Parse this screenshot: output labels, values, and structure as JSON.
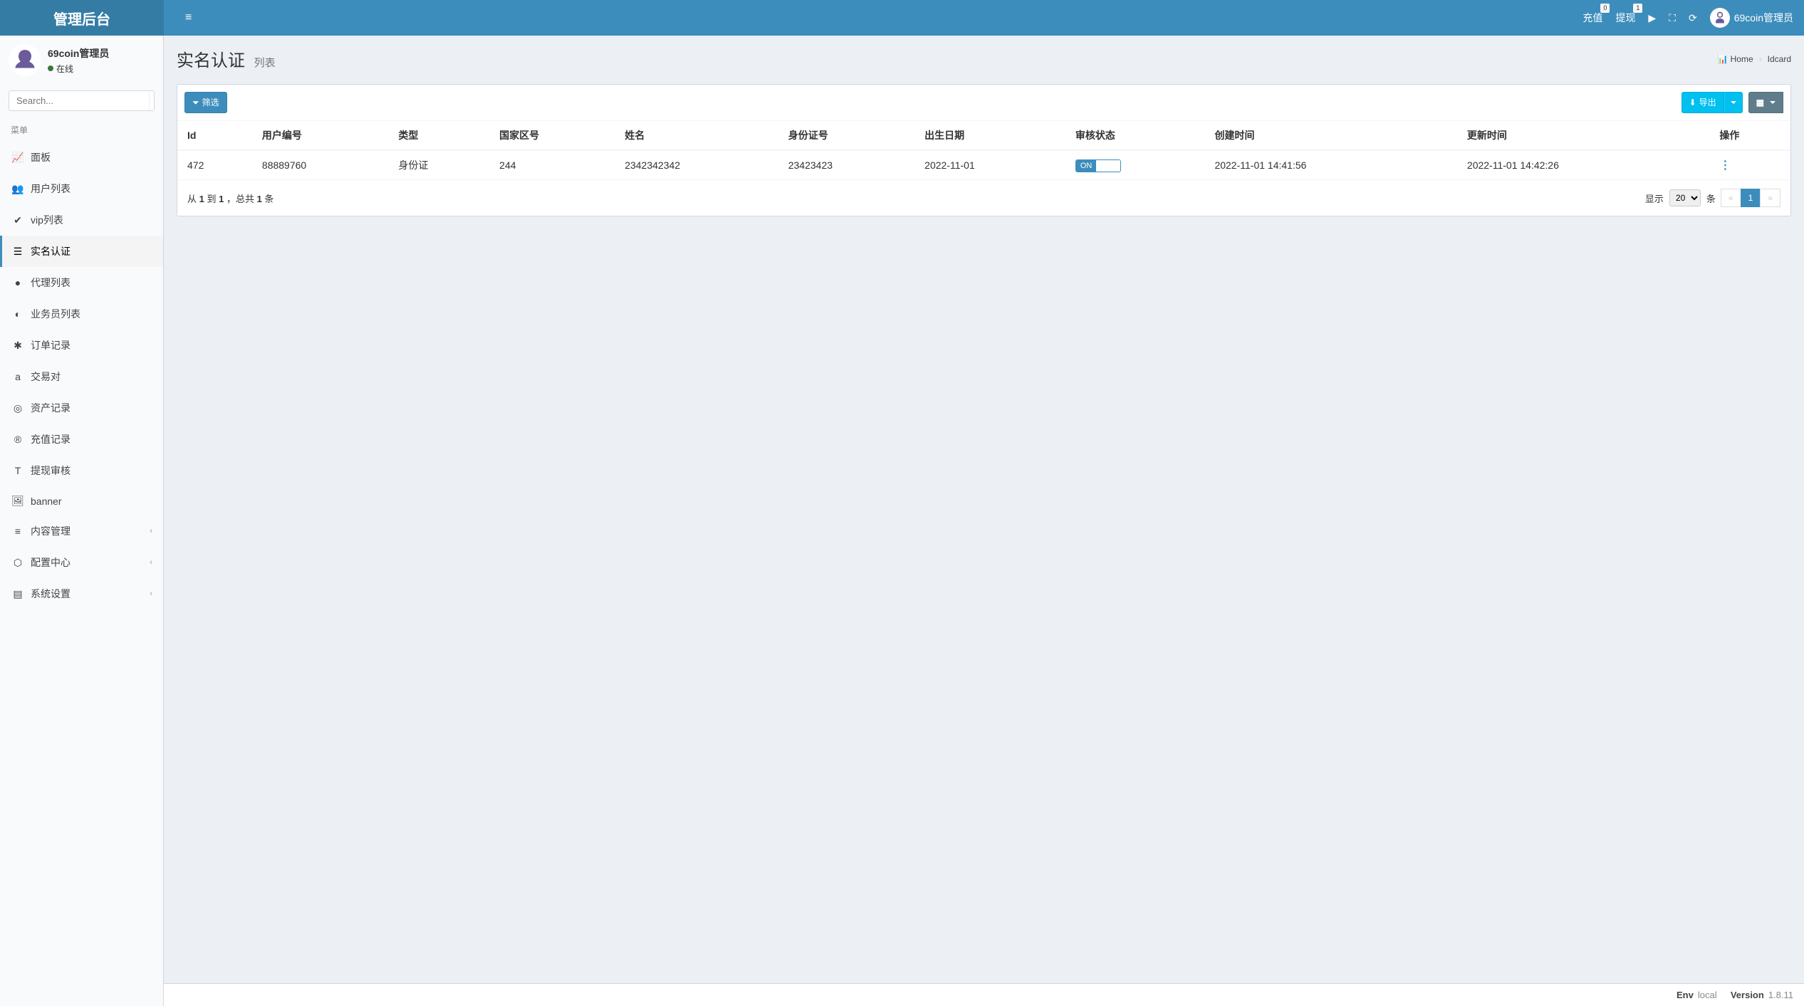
{
  "brand": "管理后台",
  "header": {
    "recharge": {
      "label": "充值",
      "badge": "0"
    },
    "withdraw": {
      "label": "提现",
      "badge": "1"
    },
    "username": "69coin管理员"
  },
  "sidebar": {
    "user": {
      "name": "69coin管理员",
      "status": "在线"
    },
    "search_placeholder": "Search...",
    "menu_header": "菜单",
    "items": [
      {
        "label": "面板",
        "icon": "📈"
      },
      {
        "label": "用户列表",
        "icon": "👥"
      },
      {
        "label": "vip列表",
        "icon": "✔"
      },
      {
        "label": "实名认证",
        "icon": "☰",
        "active": true
      },
      {
        "label": "代理列表",
        "icon": "●"
      },
      {
        "label": "业务员列表",
        "icon": "◐"
      },
      {
        "label": "订单记录",
        "icon": "✱"
      },
      {
        "label": "交易对",
        "icon": "a"
      },
      {
        "label": "资产记录",
        "icon": "◎"
      },
      {
        "label": "充值记录",
        "icon": "®"
      },
      {
        "label": "提现审核",
        "icon": "T"
      },
      {
        "label": "banner",
        "icon": "🖼"
      },
      {
        "label": "内容管理",
        "icon": "≡",
        "expandable": true
      },
      {
        "label": "配置中心",
        "icon": "⬡",
        "expandable": true
      },
      {
        "label": "系统设置",
        "icon": "▤",
        "expandable": true
      }
    ]
  },
  "page": {
    "title": "实名认证",
    "subtitle": "列表",
    "breadcrumb": {
      "home": "Home",
      "current": "Idcard"
    }
  },
  "toolbar": {
    "filter": "筛选",
    "export": "导出"
  },
  "table": {
    "columns": [
      "Id",
      "用户编号",
      "类型",
      "国家区号",
      "姓名",
      "身份证号",
      "出生日期",
      "审核状态",
      "创建时间",
      "更新时间",
      "操作"
    ],
    "rows": [
      {
        "id": "472",
        "user_no": "88889760",
        "type": "身份证",
        "country_code": "244",
        "name": "2342342342",
        "id_no": "23423423",
        "birth": "2022-11-01",
        "status_on": "ON",
        "created": "2022-11-01 14:41:56",
        "updated": "2022-11-01 14:42:26"
      }
    ]
  },
  "pagination": {
    "summary_prefix": "从 ",
    "summary_from": "1",
    "summary_to_word": " 到 ",
    "summary_to": "1",
    "summary_total_word": " ，总共 ",
    "summary_total": "1",
    "summary_suffix": " 条",
    "show_label": "显示",
    "per_page": "20",
    "unit": "条",
    "prev": "«",
    "current": "1",
    "next": "»"
  },
  "footer": {
    "env_label": "Env",
    "env_value": "local",
    "version_label": "Version",
    "version_value": "1.8.11"
  }
}
